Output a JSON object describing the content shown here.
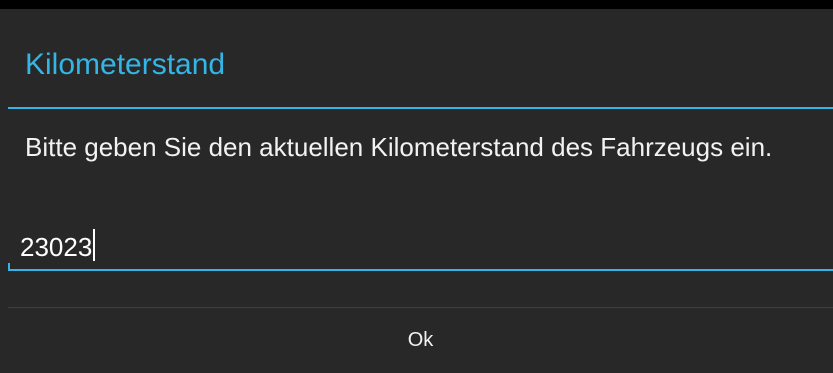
{
  "dialog": {
    "title": "Kilometerstand",
    "message": "Bitte geben Sie den aktuellen Kilometerstand des Fahrzeugs ein.",
    "input": {
      "value": "23023"
    },
    "buttons": {
      "ok_label": "Ok"
    }
  },
  "colors": {
    "accent": "#33b5e5",
    "dialog_background": "#282828",
    "text": "#f2f2f2"
  }
}
